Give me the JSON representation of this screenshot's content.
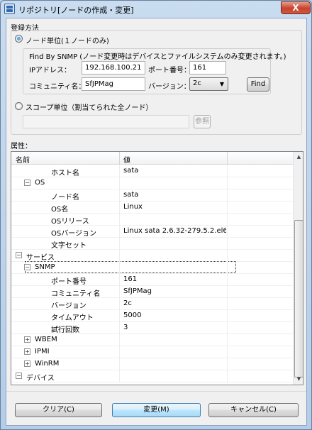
{
  "window": {
    "title": "リポジトリ[ノードの作成・変更]",
    "close_label": "X"
  },
  "registration": {
    "group_label": "登録方法",
    "node_option_label": "ノード単位(１ノードのみ)",
    "find_snmp_note": "Find By SNMP (ノード変更時はデバイスとファイルシステムのみ変更されます。)",
    "ip_label": "IPアドレス：",
    "ip_value": "192.168.100.21",
    "port_label": "ポート番号：",
    "port_value": "161",
    "community_label": "コミュニティ名：",
    "community_value": "SfJPMag",
    "version_label": "バージョン：",
    "version_value": "2c",
    "find_button": "Find",
    "scope_option_label": "スコープ単位（割当てられた全ノード）",
    "scope_value": "",
    "browse_button": "参照"
  },
  "attributes": {
    "section_label": "属性：",
    "columns": [
      "名前",
      "値"
    ],
    "rows": [
      {
        "expander": "",
        "name": "ホスト名",
        "value": "sata"
      },
      {
        "expander": "−",
        "name": "OS",
        "value": ""
      },
      {
        "expander": "",
        "name": "ノード名",
        "value": "sata"
      },
      {
        "expander": "",
        "name": "OS名",
        "value": "Linux"
      },
      {
        "expander": "",
        "name": "OSリリース",
        "value": ""
      },
      {
        "expander": "",
        "name": "OSバージョン",
        "value": "Linux sata 2.6.32-279.5.2.el6...."
      },
      {
        "expander": "",
        "name": "文字セット",
        "value": ""
      },
      {
        "expander": "−",
        "name": "サービス",
        "value": ""
      },
      {
        "expander": "−",
        "name": "SNMP",
        "value": ""
      },
      {
        "expander": "",
        "name": "ポート番号",
        "value": "161"
      },
      {
        "expander": "",
        "name": "コミュニティ名",
        "value": "SfJPMag"
      },
      {
        "expander": "",
        "name": "バージョン",
        "value": "2c"
      },
      {
        "expander": "",
        "name": "タイムアウト",
        "value": "5000"
      },
      {
        "expander": "",
        "name": "試行回数",
        "value": "3"
      },
      {
        "expander": "+",
        "name": "WBEM",
        "value": ""
      },
      {
        "expander": "+",
        "name": "IPMI",
        "value": ""
      },
      {
        "expander": "+",
        "name": "WinRM",
        "value": ""
      },
      {
        "expander": "−",
        "name": "デバイス",
        "value": ""
      }
    ]
  },
  "footer": {
    "clear_button": "クリア(C)",
    "change_button": "変更(M)",
    "cancel_button": "キャンセル(C)"
  }
}
